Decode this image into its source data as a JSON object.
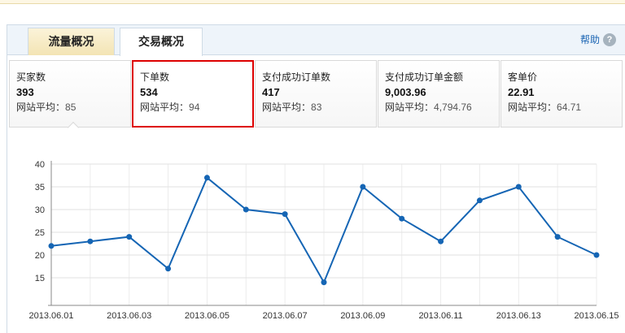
{
  "tabs": [
    {
      "label": "流量概况",
      "active": false
    },
    {
      "label": "交易概况",
      "active": true
    }
  ],
  "help": {
    "label": "帮助",
    "icon": "question-mark-icon",
    "glyph": "?"
  },
  "avg_label": "网站平均：",
  "metrics": [
    {
      "label": "买家数",
      "value": "393",
      "avg": "85",
      "selected": false
    },
    {
      "label": "下单数",
      "value": "534",
      "avg": "94",
      "selected": true
    },
    {
      "label": "支付成功订单数",
      "value": "417",
      "avg": "83",
      "selected": false
    },
    {
      "label": "支付成功订单金额",
      "value": "9,003.96",
      "avg": "4,794.76",
      "selected": false
    },
    {
      "label": "客单价",
      "value": "22.91",
      "avg": "64.71",
      "selected": false
    }
  ],
  "colors": {
    "line": "#1565b4",
    "highlight": "#dd0000",
    "help_link": "#1a64b3"
  },
  "chart_data": {
    "type": "line",
    "x": [
      "2013.06.01",
      "2013.06.02",
      "2013.06.03",
      "2013.06.04",
      "2013.06.05",
      "2013.06.06",
      "2013.06.07",
      "2013.06.08",
      "2013.06.09",
      "2013.06.10",
      "2013.06.11",
      "2013.06.12",
      "2013.06.13",
      "2013.06.14",
      "2013.06.15"
    ],
    "x_tick_labels": [
      "2013.06.01",
      "2013.06.03",
      "2013.06.05",
      "2013.06.07",
      "2013.06.09",
      "2013.06.11",
      "2013.06.13",
      "2013.06.15"
    ],
    "series": [
      {
        "values": [
          22,
          23,
          24,
          17,
          37,
          30,
          29,
          14,
          35,
          28,
          23,
          32,
          35,
          24,
          20
        ]
      }
    ],
    "y_ticks": [
      15,
      20,
      25,
      30,
      35,
      40
    ],
    "ylim": [
      10,
      40
    ],
    "grid": true
  }
}
